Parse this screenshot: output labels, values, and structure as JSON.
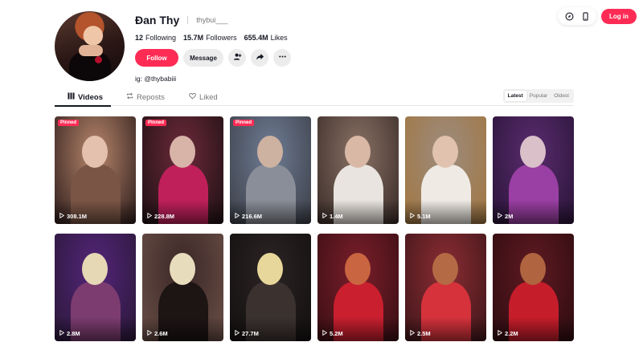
{
  "header": {
    "login_label": "Log in",
    "icons": [
      "compass-icon",
      "phone-icon"
    ]
  },
  "profile": {
    "display_name": "Đan Thy",
    "username": "thybui___",
    "following_count": "12",
    "following_label": "Following",
    "followers_count": "15.7M",
    "followers_label": "Followers",
    "likes_count": "655.4M",
    "likes_label": "Likes",
    "follow_label": "Follow",
    "message_label": "Message",
    "bio": "ig: @thybabiii"
  },
  "tabs": [
    {
      "label": "Videos",
      "icon": "grid-icon",
      "active": true
    },
    {
      "label": "Reposts",
      "icon": "repost-icon",
      "active": false
    },
    {
      "label": "Liked",
      "icon": "heart-icon",
      "active": false
    }
  ],
  "sort": [
    {
      "label": "Latest",
      "active": true
    },
    {
      "label": "Popular",
      "active": false
    },
    {
      "label": "Oldest",
      "active": false
    }
  ],
  "pinned_label": "Pinned",
  "videos": [
    {
      "views": "308.1M",
      "pinned": true,
      "colors": [
        "#b8876c",
        "#7a5545",
        "#2e1d1c",
        "#e4c1ae"
      ]
    },
    {
      "views": "228.8M",
      "pinned": true,
      "colors": [
        "#6d2a3a",
        "#c0205a",
        "#1e1014",
        "#d7b3a8"
      ]
    },
    {
      "views": "216.6M",
      "pinned": true,
      "colors": [
        "#6f7d96",
        "#8a8e98",
        "#3c3f47",
        "#cdb2a1"
      ]
    },
    {
      "views": "1.4M",
      "pinned": false,
      "colors": [
        "#8a7266",
        "#e9e4df",
        "#3a2c28",
        "#d9b8a6"
      ]
    },
    {
      "views": "5.1M",
      "pinned": false,
      "colors": [
        "#9c8c80",
        "#efeae4",
        "#a2763f",
        "#e1c2ae"
      ]
    },
    {
      "views": "2M",
      "pinned": false,
      "colors": [
        "#5a2c6f",
        "#9a3fa3",
        "#2a1438",
        "#d9c0c9"
      ]
    },
    {
      "views": "2.8M",
      "pinned": false,
      "colors": [
        "#54257a",
        "#7c3c70",
        "#2a1838",
        "#e6d7b5"
      ]
    },
    {
      "views": "2.6M",
      "pinned": false,
      "colors": [
        "#3a2626",
        "#1d1414",
        "#6a4f46",
        "#e7dcbc"
      ]
    },
    {
      "views": "27.7M",
      "pinned": false,
      "colors": [
        "#2b2424",
        "#3b3230",
        "#141010",
        "#e8d79b"
      ]
    },
    {
      "views": "5.2M",
      "pinned": false,
      "colors": [
        "#7a1f2a",
        "#c91f2f",
        "#3b0e14",
        "#c96540"
      ]
    },
    {
      "views": "2.5M",
      "pinned": false,
      "colors": [
        "#8b2d33",
        "#d6323c",
        "#40161a",
        "#b46b45"
      ]
    },
    {
      "views": "2.2M",
      "pinned": false,
      "colors": [
        "#5f1a22",
        "#c61d2b",
        "#2e0c10",
        "#b0643f"
      ]
    }
  ],
  "colors": {
    "accent": "#fe2c55",
    "text": "#161823",
    "muted": "#757575"
  }
}
